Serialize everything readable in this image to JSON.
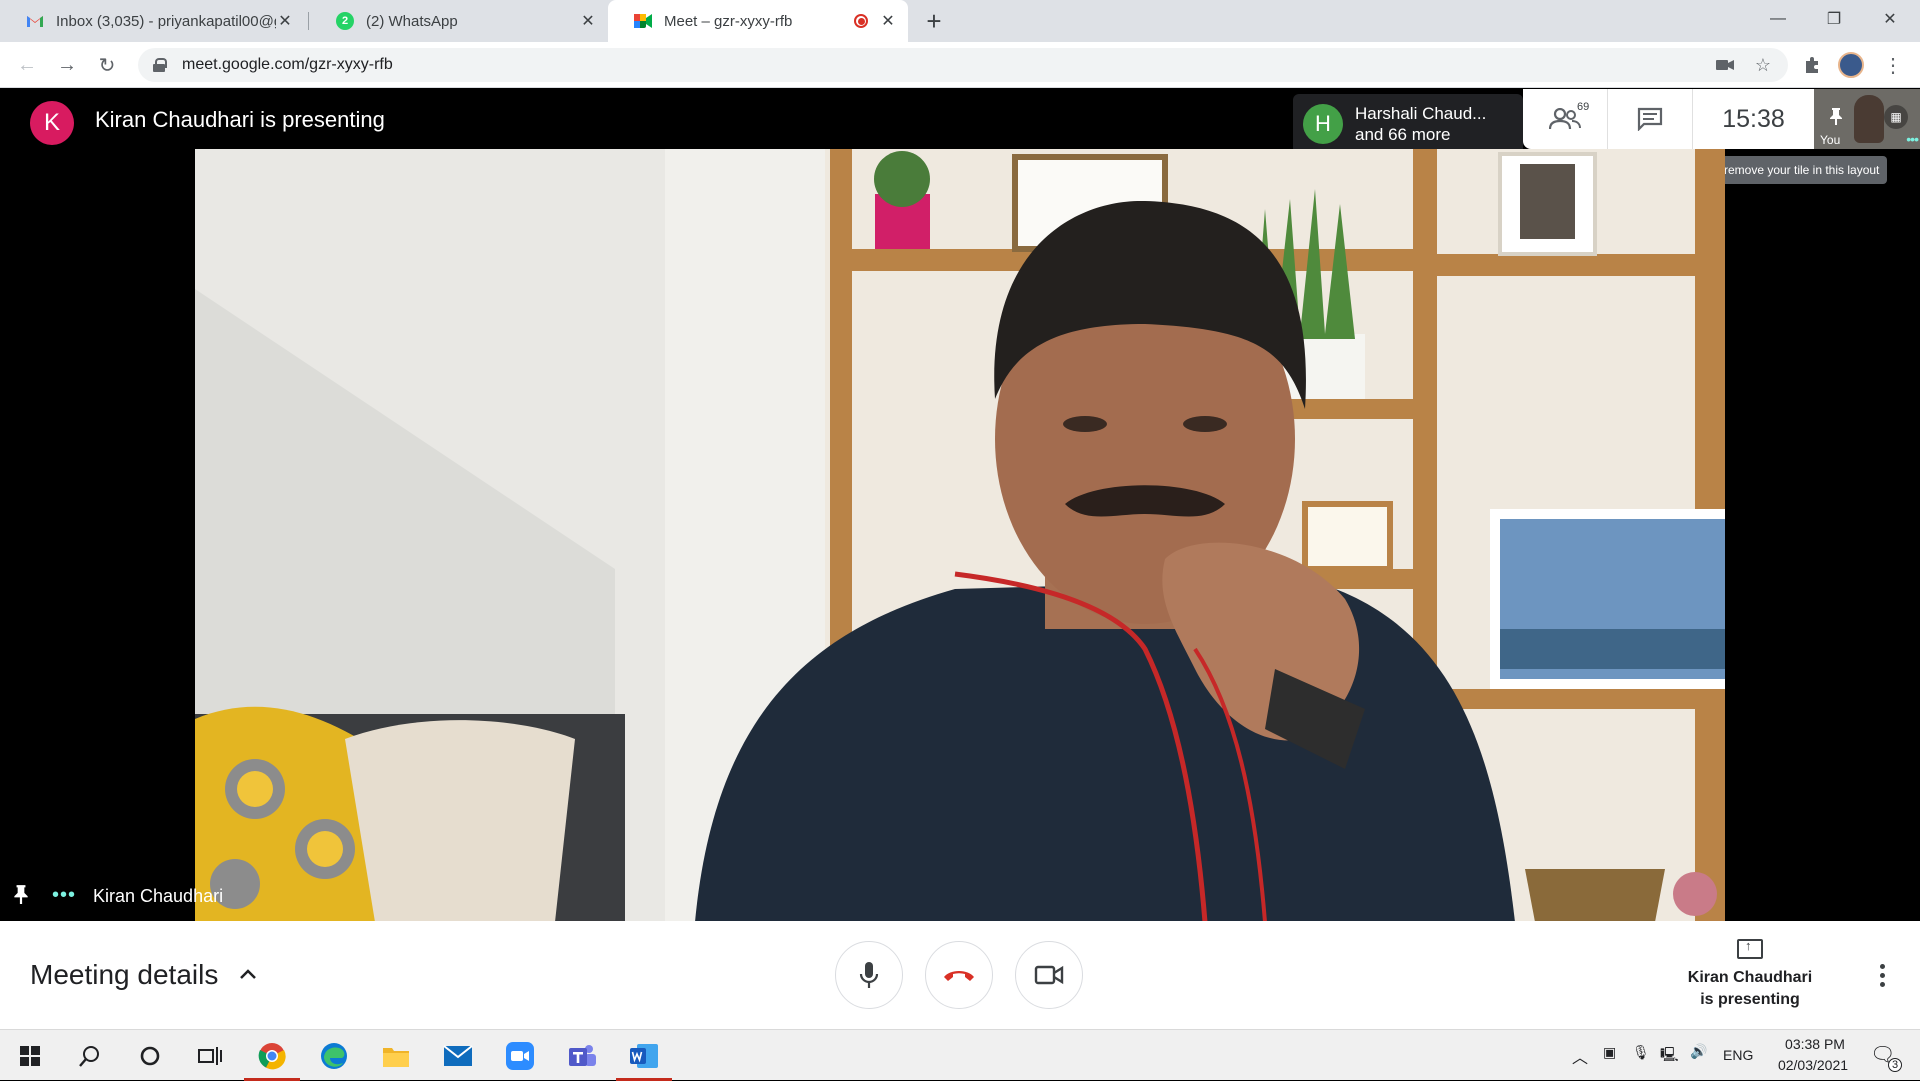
{
  "browser": {
    "tabs": [
      {
        "title": "Inbox (3,035) - priyankapatil00@g",
        "favicon": "gmail-icon",
        "active": false
      },
      {
        "title": "(2) WhatsApp",
        "favicon": "whatsapp-icon",
        "badge": "2",
        "active": false
      },
      {
        "title": "Meet – gzr-xyxy-rfb",
        "favicon": "google-meet-icon",
        "active": true,
        "recording": true
      }
    ],
    "url": "meet.google.com/gzr-xyxy-rfb"
  },
  "meet": {
    "presenter_initial": "K",
    "presenter_banner": "Kiran Chaudhari is presenting",
    "participants_initial": "H",
    "participants_line1": "Harshali Chaud...",
    "participants_line2": "and 66 more",
    "participant_count": "69",
    "clock": "15:38",
    "self_label": "You",
    "tooltip": "Can't remove your tile in this layout",
    "tile_name": "Kiran Chaudhari",
    "meeting_details_label": "Meeting details",
    "present_status_line1": "Kiran Chaudhari",
    "present_status_line2": "is presenting",
    "colors": {
      "presenter_avatar": "#d81b60",
      "participant_avatar": "#43a047",
      "end_call": "#d93025",
      "accent_dots": "#7cf1e0"
    }
  },
  "taskbar": {
    "apps": [
      "windows-start-icon",
      "search-icon",
      "cortana-icon",
      "task-view-icon",
      "chrome-icon",
      "edge-icon",
      "file-explorer-icon",
      "mail-icon",
      "zoom-icon",
      "teams-icon",
      "word-icon"
    ],
    "language": "ENG",
    "time": "03:38 PM",
    "date": "02/03/2021",
    "notification_count": "3"
  }
}
